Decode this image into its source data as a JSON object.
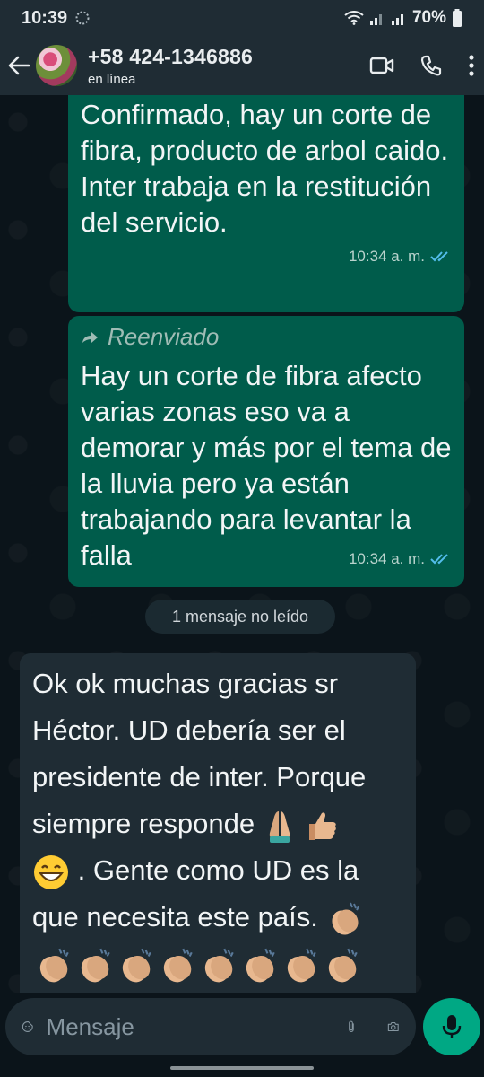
{
  "status_bar": {
    "time": "10:39",
    "battery": "70%"
  },
  "header": {
    "contact_name": "+58 424-1346886",
    "contact_status": "en línea"
  },
  "messages": [
    {
      "text": "Confirmado, hay un corte de fibra, producto de arbol caido.\nInter trabaja en la restitución del servicio.",
      "time": "10:34 a. m."
    },
    {
      "forwarded_label": "Reenviado",
      "text": "Hay un corte de fibra afecto varias zonas eso va a demorar y más por el tema de la lluvia pero ya están trabajando para levantar la falla",
      "time": "10:34 a. m."
    }
  ],
  "unread_divider": "1 mensaje no leído",
  "incoming": {
    "line1": "Ok ok muchas gracias sr Héctor. UD debería ser el presidente de inter. Porque siempre responde",
    "line2": ". Gente como UD es la que necesita este país."
  },
  "input": {
    "placeholder": "Mensaje"
  },
  "colors": {
    "outgoing_bubble": "#005c4b",
    "incoming_bubble": "#1f2c34",
    "accent": "#00a884",
    "read_ticks": "#53bdeb"
  },
  "icons": [
    "back-arrow-icon",
    "video-call-icon",
    "phone-icon",
    "more-options-icon",
    "emoji-sticker-icon",
    "attach-icon",
    "camera-icon",
    "mic-icon",
    "forward-icon",
    "double-check-icon"
  ]
}
